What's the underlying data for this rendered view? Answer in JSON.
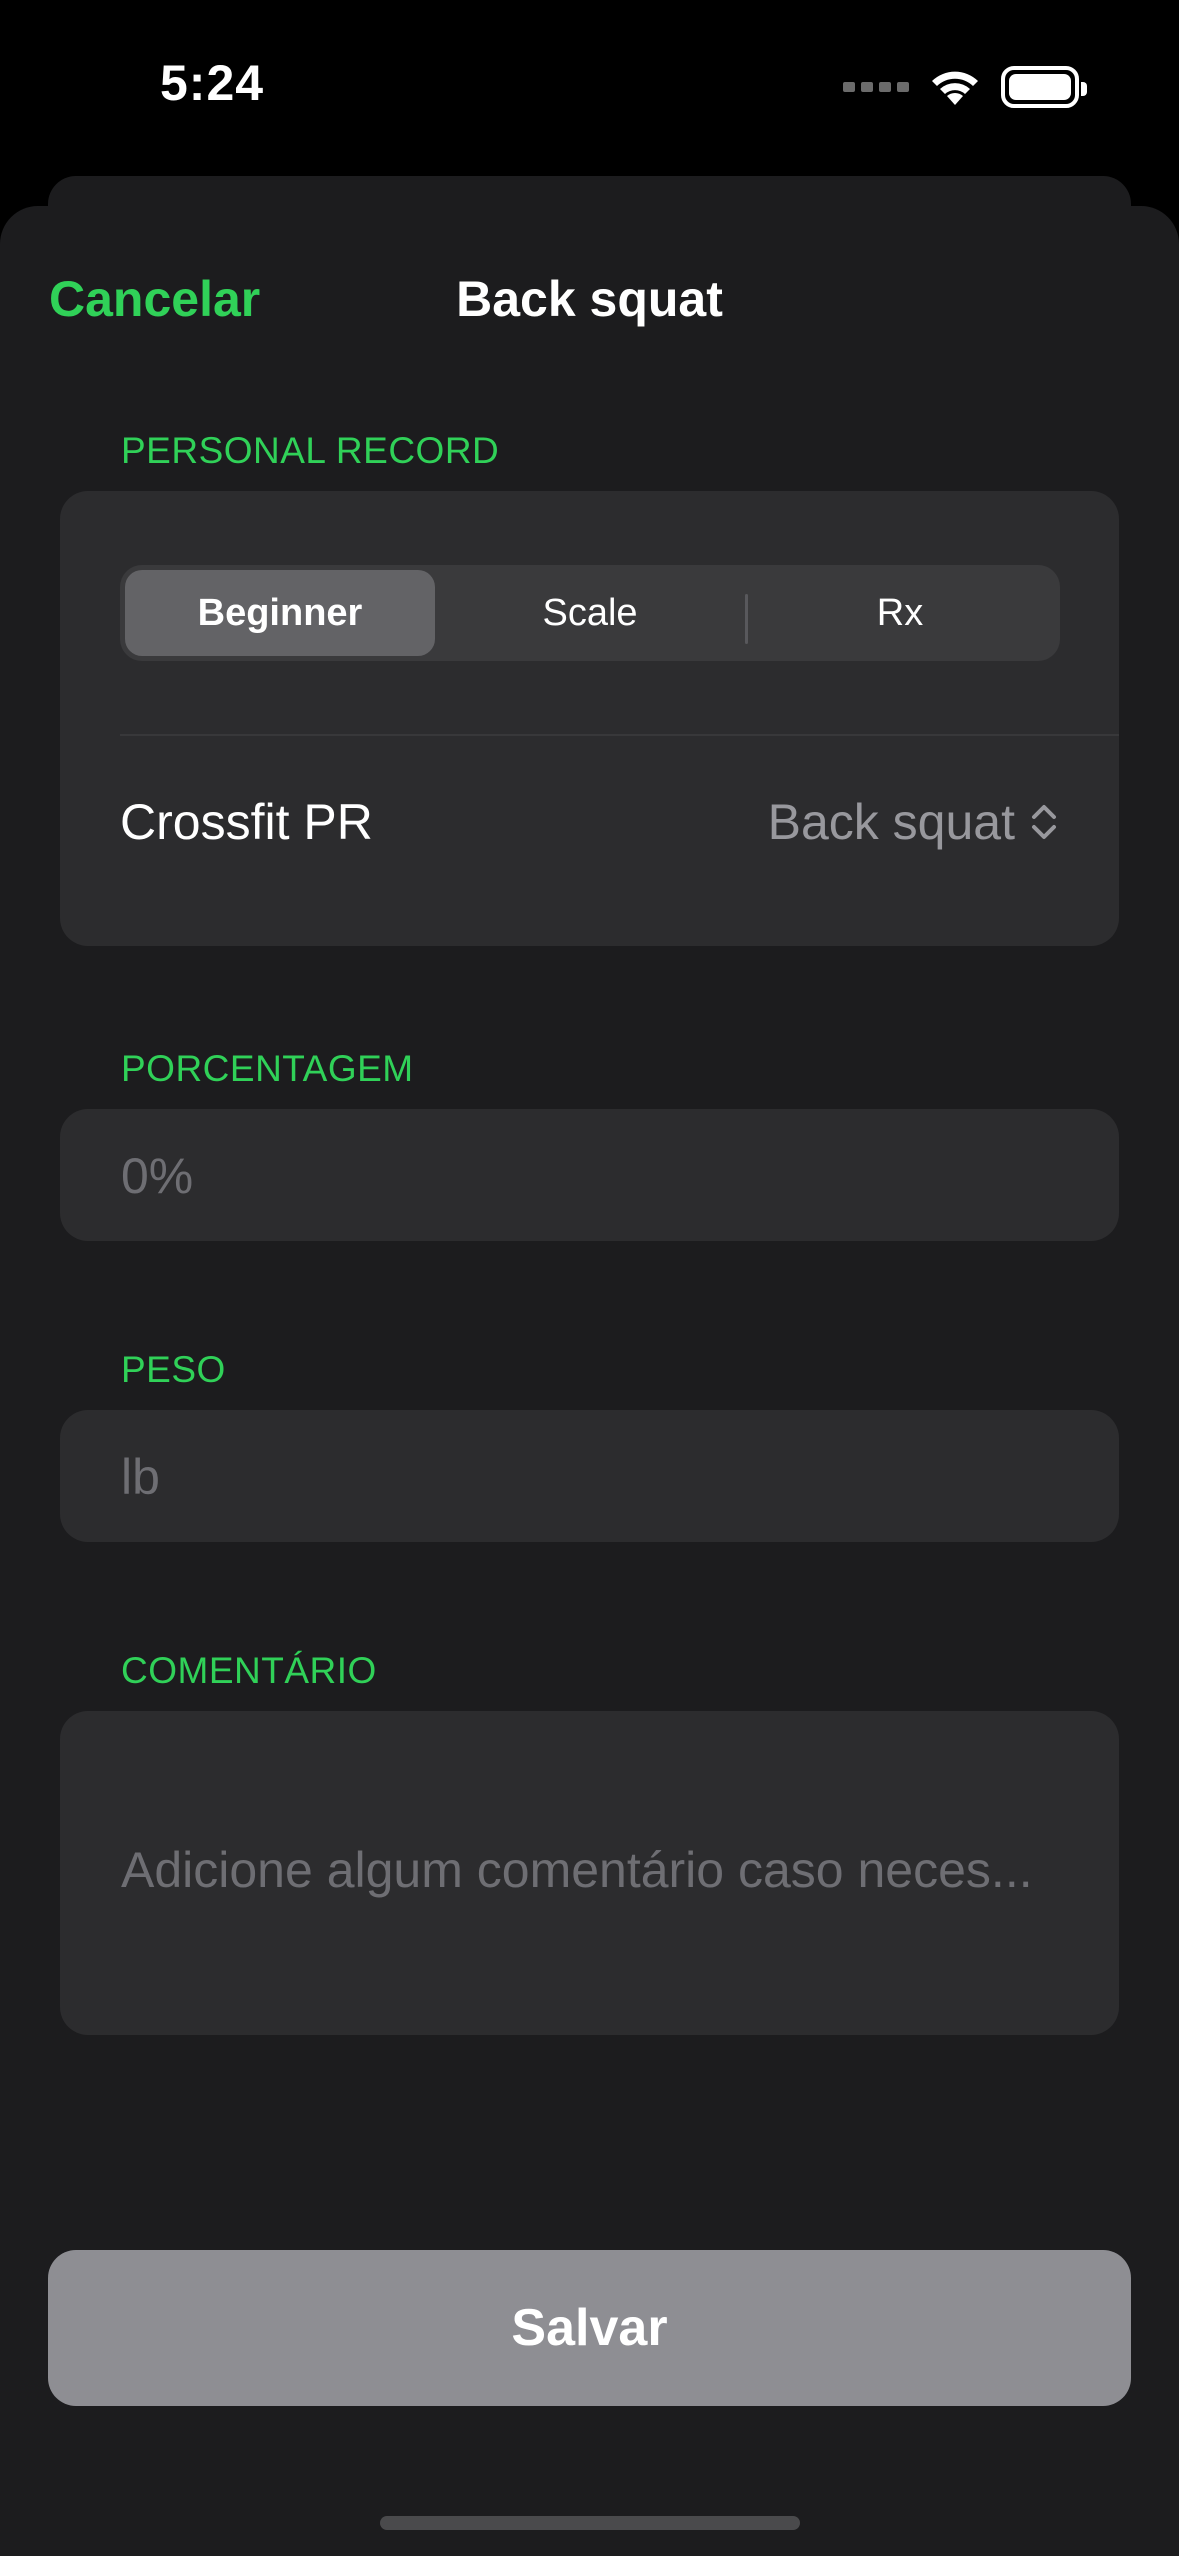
{
  "status_bar": {
    "time": "5:24"
  },
  "nav": {
    "cancel_label": "Cancelar",
    "title": "Back squat"
  },
  "personal_record": {
    "header": "PERSONAL RECORD",
    "segments": [
      "Beginner",
      "Scale",
      "Rx"
    ],
    "selected_segment": "Beginner",
    "picker_label": "Crossfit PR",
    "picker_value": "Back squat"
  },
  "percentage": {
    "header": "PORCENTAGEM",
    "placeholder": "0%"
  },
  "weight": {
    "header": "PESO",
    "placeholder": "lb"
  },
  "comment": {
    "header": "COMENTÁRIO",
    "placeholder": "Adicione algum comentário caso neces..."
  },
  "save_label": "Salvar",
  "colors": {
    "accent": "#30d158",
    "sheet": "#1c1c1e",
    "group": "#2c2c2e",
    "button_disabled": "#8e8e93"
  }
}
